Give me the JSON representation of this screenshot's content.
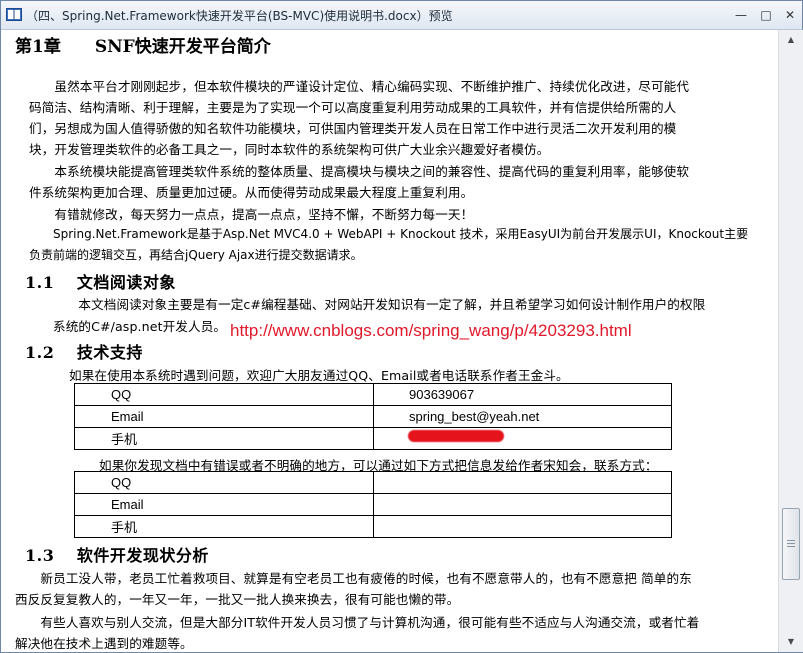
{
  "window": {
    "title": "（四、Spring.Net.Framework快速开发平台(BS-MVC)使用说明书.docx）预览",
    "buttons": {
      "minimize": "—",
      "maximize": "□",
      "close": "✕"
    }
  },
  "doc": {
    "chapter_title": "第1章　　SNF快速开发平台简介",
    "intro": [
      "　　虽然本平台才刚刚起步，但本软件模块的严谨设计定位、精心编码实现、不断维护推广、持续优化改进，尽可能代",
      "码简洁、结构清晰、利于理解，主要是为了实现一个可以高度重复利用劳动成果的工具软件，并有信提供给所需的人",
      "们，另想成为国人值得骄傲的知名软件功能模块，可供国内管理类开发人员在日常工作中进行灵活二次开发利用的模",
      "块，开发管理类软件的必备工具之一，同时本软件的系统架构可供广大业余兴趣爱好者模仿。",
      "　　本系统模块能提高管理类软件系统的整体质量、提高模块与模块之间的兼容性、提高代码的重复利用率，能够使软",
      "件系统架构更加合理、质量更加过硬。从而使得劳动成果最大程度上重复利用。",
      "　　有错就修改，每天努力一点点，提高一点点，坚持不懈，不断努力每一天！",
      "　　Spring.Net.Framework是基于Asp.Net MVC4.0 + WebAPI + Knockout 技术，采用EasyUI为前台开发展示UI，Knockout主要",
      "负责前端的逻辑交互，再结合jQuery Ajax进行提交数据请求。"
    ],
    "section_1_1": {
      "title": "1.1　 文档阅读对象",
      "lines": [
        "　　本文档阅读对象主要是有一定c#编程基础、对网站开发知识有一定了解，并且希望学习如何设计制作用户的权限",
        "系统的C#/asp.net开发人员。"
      ],
      "url_overlay": "http://www.cnblogs.com/spring_wang/p/4203293.html"
    },
    "section_1_2": {
      "title": "1.2　 技术支持",
      "line": "如果在使用本系统时遇到问题，欢迎广大朋友通过QQ、Email或者电话联系作者王金斗。",
      "contact_table": [
        {
          "label": "QQ",
          "value": "903639067"
        },
        {
          "label": "Email",
          "value": "spring_best@yeah.net"
        },
        {
          "label": "手机",
          "value": ""
        }
      ],
      "feedback_line": "如果你发现文档中有错误或者不明确的地方，可以通过如下方式把信息发给作者宋知会，联系方式：",
      "feedback_table": [
        {
          "label": "QQ",
          "value": ""
        },
        {
          "label": "Email",
          "value": ""
        },
        {
          "label": "手机",
          "value": ""
        }
      ]
    },
    "section_1_3": {
      "title": "1.3　 软件开发现状分析",
      "lines": [
        "　　新员工没人带，老员工忙着救项目、就算是有空老员工也有疲倦的时候，也有不愿意带人的，也有不愿意把 简单的东",
        "西反反复复教人的，一年又一年，一批又一批人换来换去，很有可能也懒的带。",
        "　　有些人喜欢与别人交流，但是大部分IT软件开发人员习惯了与计算机沟通，很可能有些不适应与人沟通交流，或者忙着",
        "解决他在技术上遇到的难题等。"
      ]
    }
  },
  "colors": {
    "link": "#e0182a",
    "redaction": "#e5141c",
    "title_bg": "#dfe7f1"
  }
}
